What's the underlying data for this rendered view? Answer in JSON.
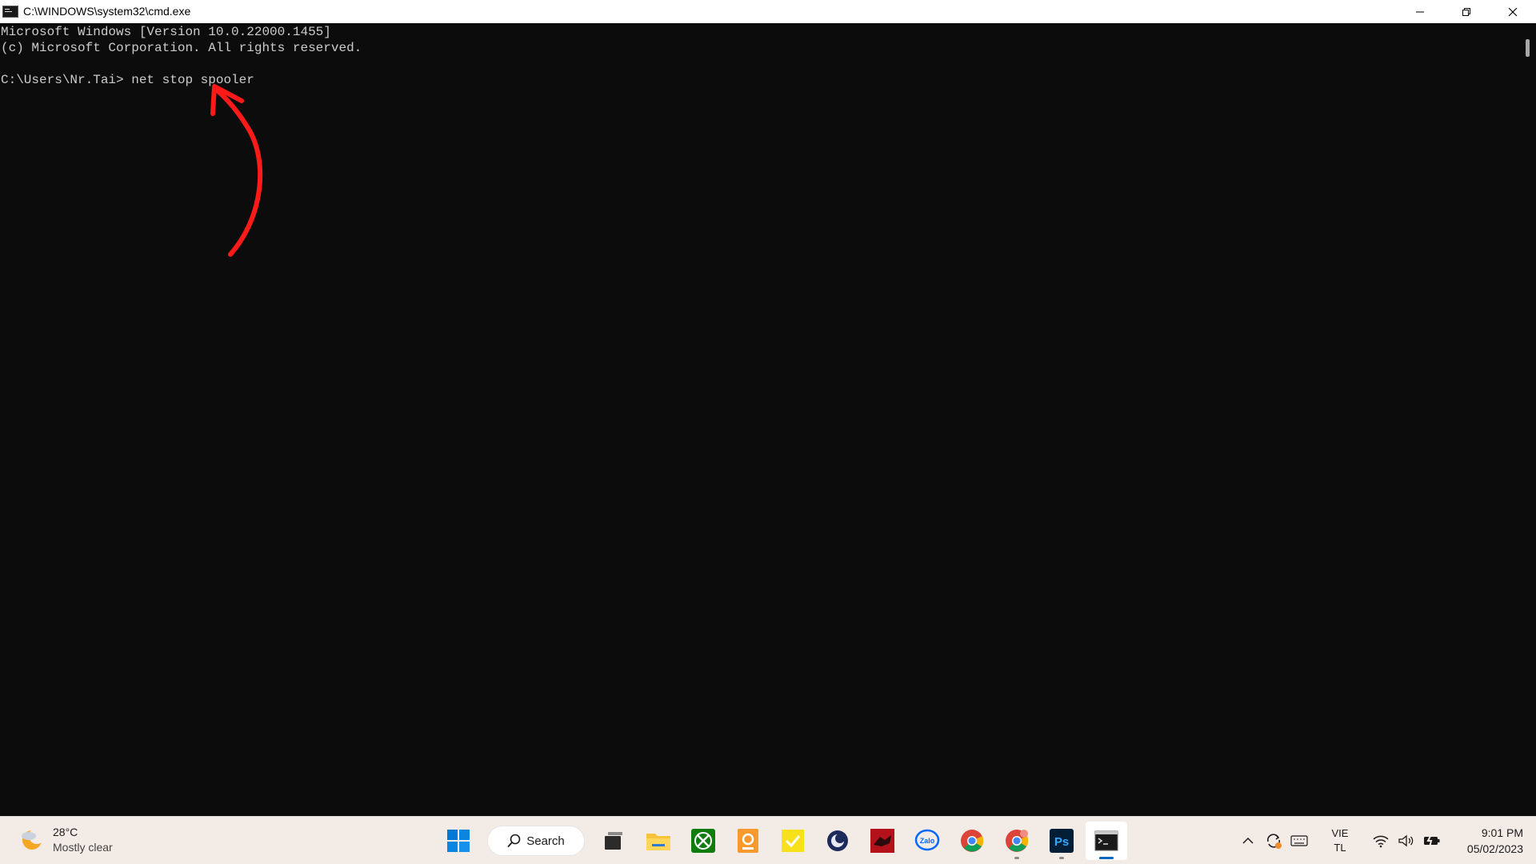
{
  "window": {
    "title": "C:\\WINDOWS\\system32\\cmd.exe"
  },
  "console": {
    "lines": [
      "Microsoft Windows [Version 10.0.22000.1455]",
      "(c) Microsoft Corporation. All rights reserved.",
      "",
      "C:\\Users\\Nr.Tai> net stop spooler"
    ]
  },
  "annotation": {
    "color": "#ff1a1a"
  },
  "taskbar": {
    "weather": {
      "temperature": "28°C",
      "condition": "Mostly clear"
    },
    "search_label": "Search",
    "language": {
      "line1": "VIE",
      "line2": "TL"
    },
    "clock": {
      "time": "9:01 PM",
      "date": "05/02/2023"
    },
    "accent": "#0067c0"
  }
}
